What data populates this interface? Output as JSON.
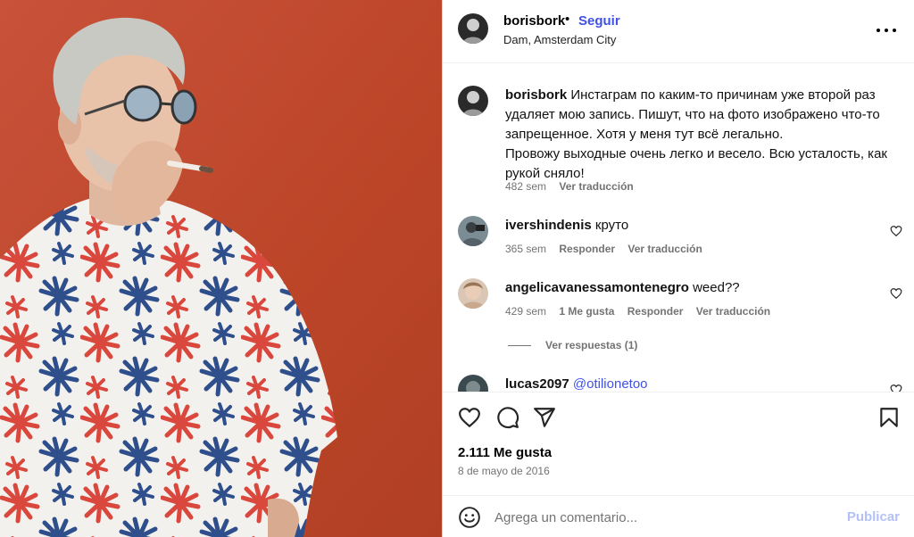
{
  "post": {
    "username": "borisbork",
    "separator": "•",
    "follow_label": "Seguir",
    "location": "Dam, Amsterdam City",
    "caption_user": "borisbork",
    "caption_text": "Инстаграм по каким-то причинам уже второй раз удаляет мою запись. Пишут, что на фото изображено что-то запрещенное. Хотя у меня тут всё легально.",
    "caption_text_2": "Провожу выходные очень легко и весело. Всю усталость, как рукой сняло!",
    "caption_age": "482 sem",
    "translate_label": "Ver traducción",
    "likes": "2.111 Me gusta",
    "date": "8 de mayo de 2016"
  },
  "comments": [
    {
      "user": "ivershindenis",
      "text": "круто",
      "age": "365 sem",
      "likes": "",
      "reply_label": "Responder",
      "translate_label": "Ver traducción"
    },
    {
      "user": "angelicavanessamontenegro",
      "text": "weed??",
      "age": "429 sem",
      "likes": "1 Me gusta",
      "reply_label": "Responder",
      "translate_label": "Ver traducción",
      "view_replies": "Ver respuestas (1)"
    },
    {
      "user": "lucas2097",
      "mention": "@otilionetoo"
    }
  ],
  "composer": {
    "placeholder": "Agrega un comentario...",
    "publish_label": "Publicar"
  },
  "icons": {
    "more": "more-horizontal-icon",
    "like": "heart-icon",
    "comment": "comment-bubble-icon",
    "share": "paper-plane-icon",
    "save": "bookmark-icon",
    "emoji": "smiley-icon"
  },
  "colors": {
    "accent": "#3f51e8",
    "publish_disabled": "#b3c1f6",
    "muted_text": "#737373",
    "photo_background": "#c04a2f"
  }
}
